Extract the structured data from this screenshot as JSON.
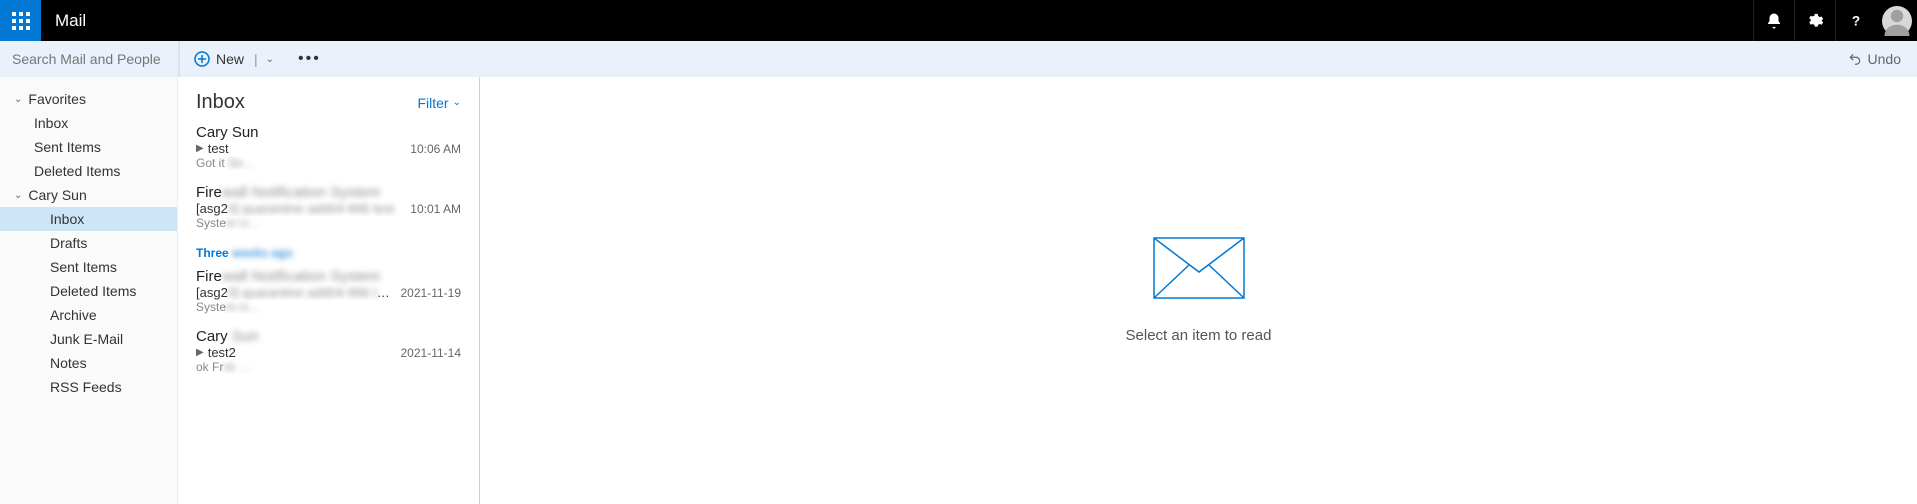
{
  "topbar": {
    "app_title": "Mail"
  },
  "search": {
    "placeholder": "Search Mail and People"
  },
  "cmd": {
    "new_label": "New",
    "undo_label": "Undo"
  },
  "nav": {
    "favorites_label": "Favorites",
    "favorites": [
      {
        "label": "Inbox"
      },
      {
        "label": "Sent Items"
      },
      {
        "label": "Deleted Items"
      }
    ],
    "account_label": "Cary Sun",
    "folders": [
      {
        "label": "Inbox",
        "selected": true
      },
      {
        "label": "Drafts"
      },
      {
        "label": "Sent Items"
      },
      {
        "label": "Deleted Items"
      },
      {
        "label": "Archive"
      },
      {
        "label": "Junk E-Mail"
      },
      {
        "label": "Notes"
      },
      {
        "label": "RSS Feeds"
      }
    ]
  },
  "messages": {
    "title": "Inbox",
    "filter_label": "Filter",
    "date_separator": "Three",
    "items": [
      {
        "from": "Cary Sun",
        "subject": "test",
        "time": "10:06 AM",
        "preview": "Got it",
        "preview_tail": " Se…",
        "expandable": true
      },
      {
        "from": "Fire",
        "from_tail": "wall Notification System",
        "subject": "[asg2",
        "subject_tail": "0] quarantine add04-996 test",
        "time": "10:01 AM",
        "preview": "Syste",
        "preview_tail": "m U…"
      },
      {
        "from": "Fire",
        "from_tail": "wall Notification System",
        "subject": "[asg2",
        "subject_tail": "0] quarantine add04-996 test",
        "time": "2021-11-19",
        "preview": "Syste",
        "preview_tail": "m U…"
      },
      {
        "from": "Cary",
        "from_tail": " Sun",
        "subject": "test2",
        "time": "2021-11-14",
        "preview": "ok Fr",
        "preview_tail": "nt: …",
        "expandable": true
      }
    ]
  },
  "reading": {
    "empty_text": "Select an item to read"
  }
}
